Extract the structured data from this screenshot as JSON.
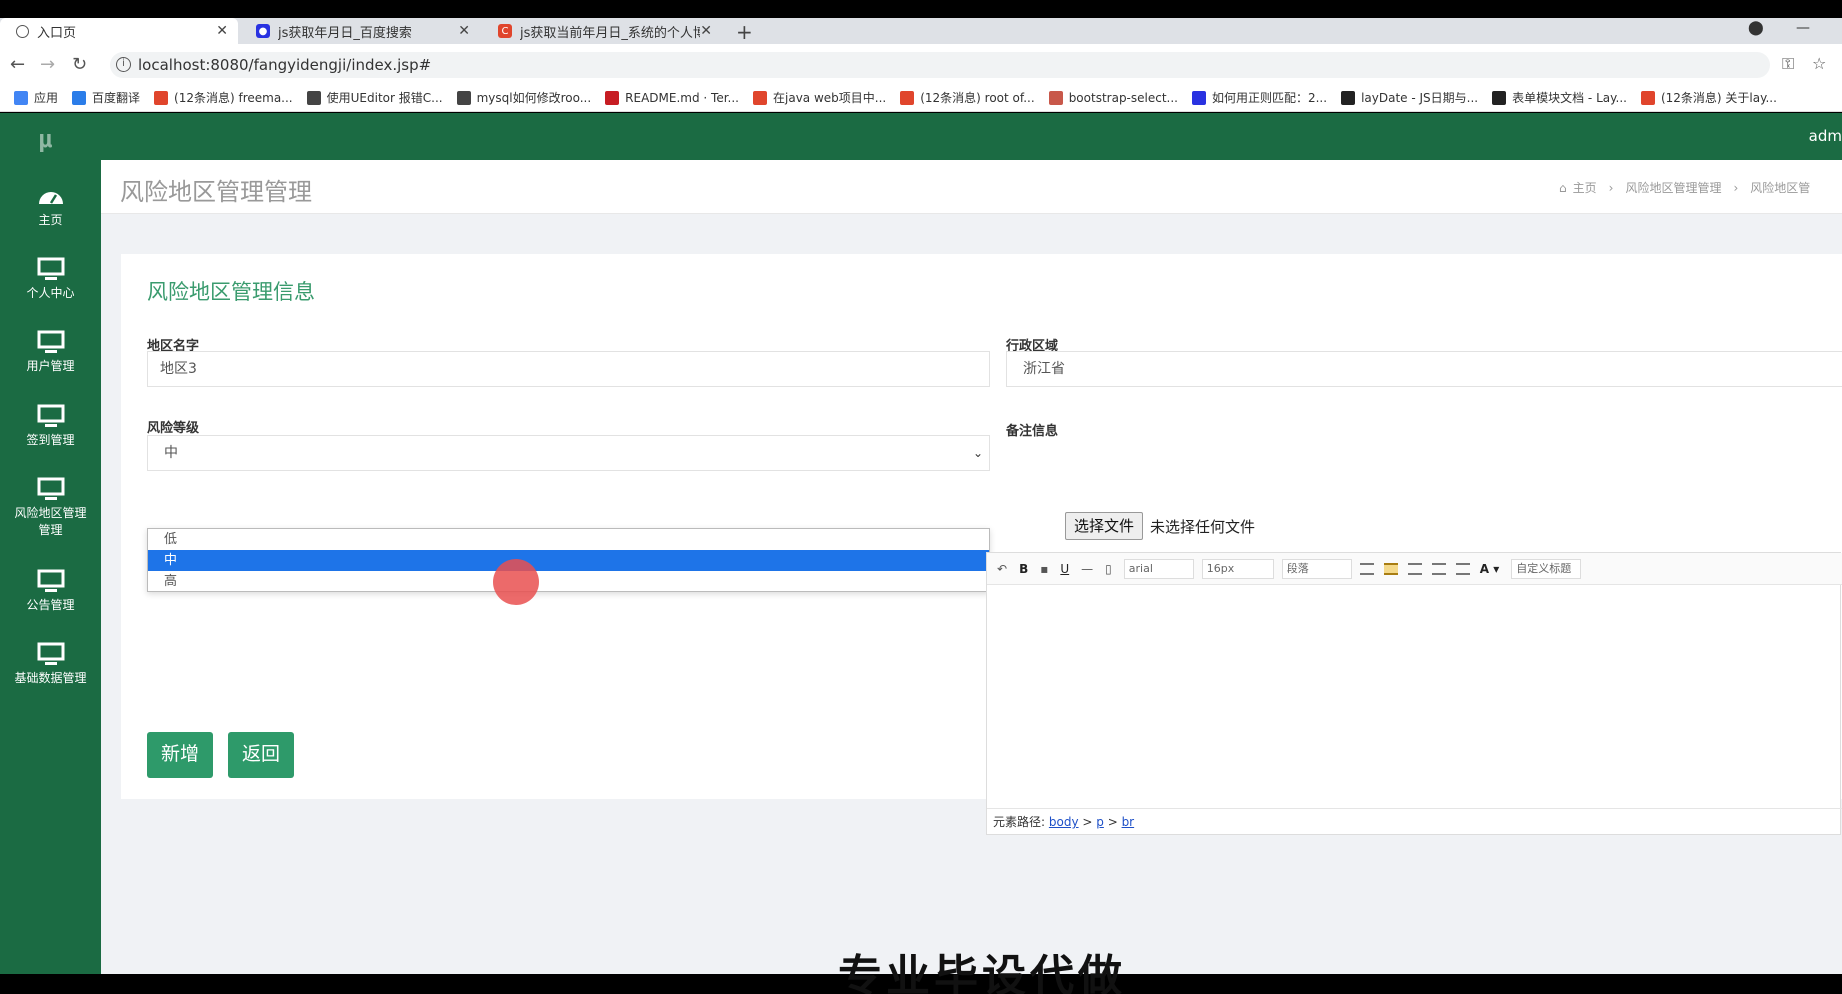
{
  "browser": {
    "tabs": [
      {
        "label": "入口页",
        "icon": "globe-icon",
        "active": true
      },
      {
        "label": "js获取年月日_百度搜索",
        "icon": "baidu-paw-icon",
        "active": false
      },
      {
        "label": "js获取当前年月日_系统的个人博",
        "icon": "csdn-icon",
        "active": false
      }
    ],
    "url": "localhost:8080/fangyidengji/index.jsp#",
    "bookmarks": [
      {
        "label": "应用",
        "icon": "apps-grid-icon",
        "color": "#4285f4"
      },
      {
        "label": "百度翻译",
        "icon": "translate-icon",
        "color": "#2b7de9"
      },
      {
        "label": "(12条消息) freema...",
        "icon": "csdn-icon",
        "color": "#e0452c"
      },
      {
        "label": "使用UEditor 报错C...",
        "icon": "ueditor-icon",
        "color": "#444"
      },
      {
        "label": "mysql如何修改roo...",
        "icon": "ueditor-icon",
        "color": "#444"
      },
      {
        "label": "README.md · Ter...",
        "icon": "gitee-icon",
        "color": "#c71d23"
      },
      {
        "label": "在java web项目中...",
        "icon": "csdn-icon",
        "color": "#e0452c"
      },
      {
        "label": "(12条消息) root of...",
        "icon": "csdn-icon",
        "color": "#e0452c"
      },
      {
        "label": "bootstrap-select...",
        "icon": "bookmark-icon",
        "color": "#c8584a"
      },
      {
        "label": "如何用正则匹配：2...",
        "icon": "baidu-paw-icon",
        "color": "#2932e1"
      },
      {
        "label": "layDate - JS日期与...",
        "icon": "layui-icon",
        "color": "#222"
      },
      {
        "label": "表单模块文档 - Lay...",
        "icon": "layui-icon",
        "color": "#222"
      },
      {
        "label": "(12条消息) 关于lay...",
        "icon": "csdn-icon",
        "color": "#e0452c"
      }
    ]
  },
  "app": {
    "logo": "μ",
    "admin_label": "adm",
    "brand_color": "#1b6b43",
    "accent_color": "#2e9a6a",
    "sidebar": {
      "items": [
        {
          "label": "主页",
          "icon": "dashboard-icon"
        },
        {
          "label": "个人中心",
          "icon": "monitor-icon"
        },
        {
          "label": "用户管理",
          "icon": "monitor-icon"
        },
        {
          "label": "签到管理",
          "icon": "monitor-icon"
        },
        {
          "label": "风险地区管理管理",
          "icon": "monitor-icon"
        },
        {
          "label": "公告管理",
          "icon": "monitor-icon"
        },
        {
          "label": "基础数据管理",
          "icon": "monitor-icon"
        }
      ]
    },
    "page_title": "风险地区管理管理",
    "breadcrumb": {
      "home": "主页",
      "level1": "风险地区管理管理",
      "level2": "风险地区管"
    },
    "form": {
      "title": "风险地区管理信息",
      "region_name_label": "地区名字",
      "region_name_value": "地区3",
      "admin_area_label": "行政区域",
      "admin_area_value": "浙江省",
      "risk_level_label": "风险等级",
      "risk_level_value": "中",
      "risk_level_options": [
        "低",
        "中",
        "高"
      ],
      "risk_level_selected_index": 1,
      "remark_label": "备注信息",
      "file_button": "选择文件",
      "file_status": "未选择任何文件",
      "editor": {
        "font_family": "arial",
        "font_size": "16px",
        "paragraph": "段落",
        "custom_title": "自定义标题",
        "path_label": "元素路径:",
        "path_body": "body",
        "path_p": "p",
        "path_br": "br"
      },
      "add_button": "新增",
      "back_button": "返回"
    }
  },
  "watermark": "专业毕设代做"
}
